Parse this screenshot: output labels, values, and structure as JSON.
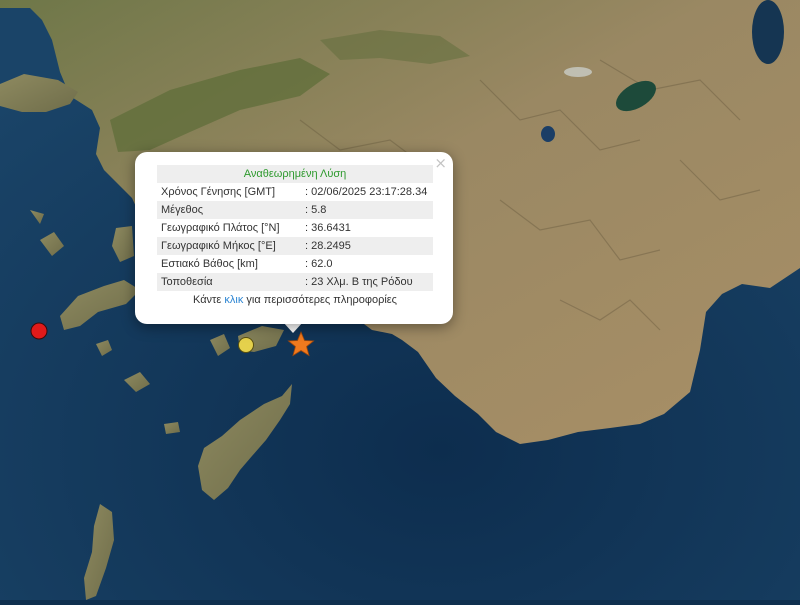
{
  "map": {
    "land_color": "#8f7e57",
    "sea_color": "#173e62",
    "epicenter_color": "#f07a1e",
    "event_markers": [
      {
        "name": "event-marker-red",
        "color": "#e11a1a"
      },
      {
        "name": "event-marker-yellow",
        "color": "#e5d14c"
      }
    ]
  },
  "popup": {
    "title": "Αναθεωρημένη Λύση",
    "rows": [
      {
        "label": "Χρόνος Γένησης [GMT]",
        "value": ": 02/06/2025 23:17:28.34"
      },
      {
        "label": "Μέγεθος",
        "value": ": 5.8"
      },
      {
        "label": "Γεωγραφικό Πλάτος [°N]",
        "value": ": 36.6431"
      },
      {
        "label": "Γεωγραφικό Μήκος [°E]",
        "value": ": 28.2495"
      },
      {
        "label": "Εστιακό Βάθος [km]",
        "value": ": 62.0"
      },
      {
        "label": "Τοποθεσία",
        "value": ": 23 Χλμ. Β της Ρόδου"
      }
    ],
    "more_prefix": "Κάντε ",
    "more_link": "κλικ",
    "more_suffix": " για περισσότερες πληροφορίες",
    "close_symbol": "×"
  }
}
